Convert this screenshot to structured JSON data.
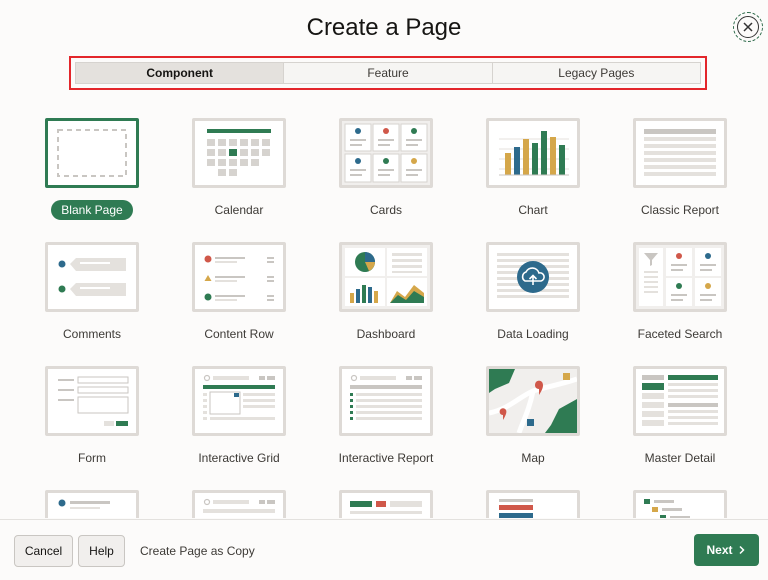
{
  "dialog": {
    "title": "Create a Page"
  },
  "tabs": [
    {
      "label": "Component",
      "active": true
    },
    {
      "label": "Feature",
      "active": false
    },
    {
      "label": "Legacy Pages",
      "active": false
    }
  ],
  "items": [
    {
      "label": "Blank Page",
      "selected": true,
      "icon": "blank-page-icon"
    },
    {
      "label": "Calendar",
      "icon": "calendar-icon"
    },
    {
      "label": "Cards",
      "icon": "cards-icon"
    },
    {
      "label": "Chart",
      "icon": "chart-icon"
    },
    {
      "label": "Classic Report",
      "icon": "classic-report-icon"
    },
    {
      "label": "Comments",
      "icon": "comments-icon"
    },
    {
      "label": "Content Row",
      "icon": "content-row-icon"
    },
    {
      "label": "Dashboard",
      "icon": "dashboard-icon"
    },
    {
      "label": "Data Loading",
      "icon": "data-loading-icon"
    },
    {
      "label": "Faceted Search",
      "icon": "faceted-search-icon"
    },
    {
      "label": "Form",
      "icon": "form-icon"
    },
    {
      "label": "Interactive Grid",
      "icon": "interactive-grid-icon"
    },
    {
      "label": "Interactive Report",
      "icon": "interactive-report-icon"
    },
    {
      "label": "Map",
      "icon": "map-icon"
    },
    {
      "label": "Master Detail",
      "icon": "master-detail-icon"
    }
  ],
  "footer": {
    "cancel_label": "Cancel",
    "help_label": "Help",
    "copy_label": "Create Page as Copy",
    "next_label": "Next"
  },
  "colors": {
    "accent": "#2f7b53",
    "highlight": "#e3262b",
    "teal": "#2d6a8c",
    "gold": "#d5a74a",
    "red": "#d0584a"
  }
}
